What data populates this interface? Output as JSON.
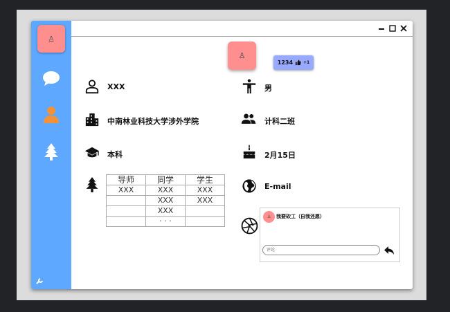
{
  "window": {
    "minimize": "minimize",
    "maximize": "maximize",
    "close": "close"
  },
  "sidebar": {
    "avatar_glyph": "♙",
    "items": [
      {
        "icon": "chat-icon"
      },
      {
        "icon": "person-icon",
        "active_color": "#f4923a"
      },
      {
        "icon": "tree-icon"
      }
    ],
    "settings_icon": "wrench-icon"
  },
  "profile": {
    "avatar_glyph": "♙",
    "likes": {
      "count": "1234",
      "plus": "+1"
    },
    "name": "XXX",
    "gender": "男",
    "school": "中南林业科技大学涉外学院",
    "class": "计科二班",
    "degree": "本科",
    "birthday": "2月15日",
    "email": "E-mail"
  },
  "relations": {
    "headers": [
      "导师",
      "同学",
      "学生"
    ],
    "rows": [
      [
        "XXX",
        "XXX",
        "XXX"
      ],
      [
        "",
        "XXX",
        "XXX"
      ],
      [
        "",
        "XXX",
        ""
      ],
      [
        "",
        "· · ·",
        ""
      ]
    ]
  },
  "comment": {
    "avatar_glyph": "♙",
    "text": "我要砍工（自我还愿）",
    "placeholder": "评论"
  },
  "colors": {
    "sidebar": "#5ea8ff",
    "avatar": "#ff8f8f",
    "badge": "#98aaff"
  }
}
